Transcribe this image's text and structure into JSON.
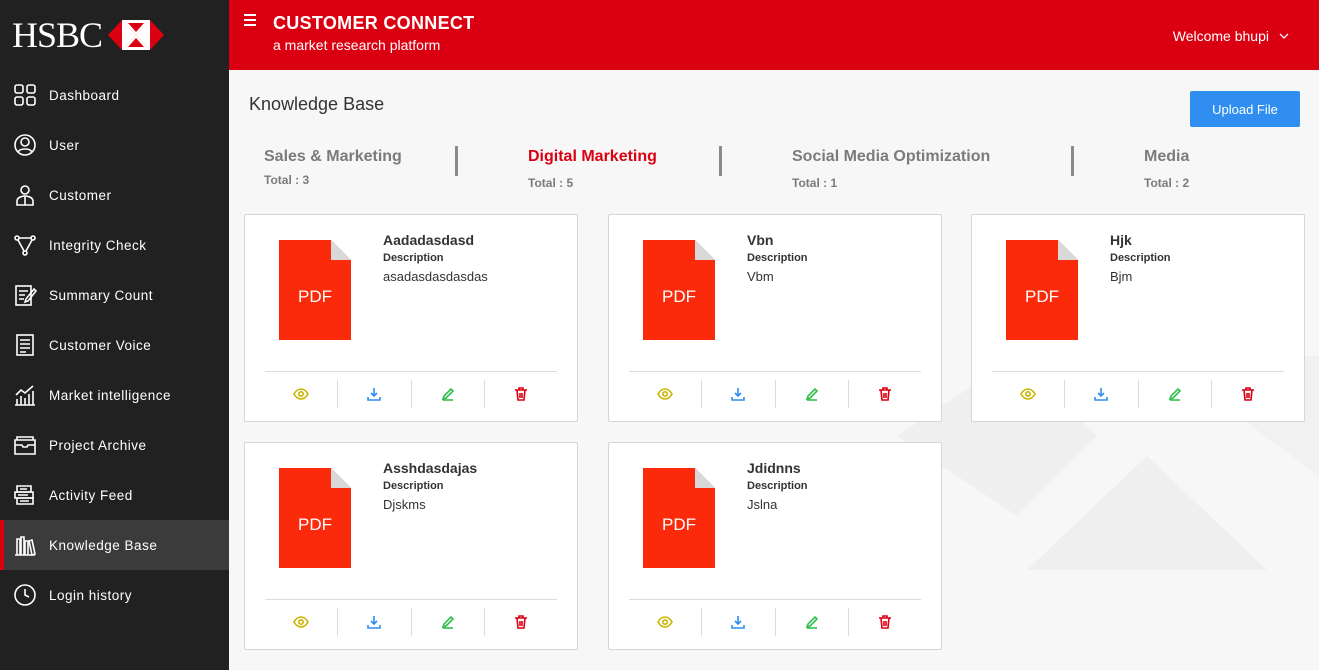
{
  "brand": {
    "logo_text": "HSBC",
    "title": "CUSTOMER CONNECT",
    "subtitle": "a market research platform"
  },
  "user": {
    "welcome": "Welcome bhupi"
  },
  "sidebar": {
    "items": [
      {
        "label": "Dashboard",
        "icon": "dashboard-icon"
      },
      {
        "label": "User",
        "icon": "user-icon"
      },
      {
        "label": "Customer",
        "icon": "customer-icon"
      },
      {
        "label": "Integrity Check",
        "icon": "integrity-check-icon"
      },
      {
        "label": "Summary Count",
        "icon": "summary-count-icon"
      },
      {
        "label": "Customer Voice",
        "icon": "customer-voice-icon"
      },
      {
        "label": "Market intelligence",
        "icon": "market-intelligence-icon"
      },
      {
        "label": "Project Archive",
        "icon": "project-archive-icon"
      },
      {
        "label": "Activity Feed",
        "icon": "activity-feed-icon"
      },
      {
        "label": "Knowledge Base",
        "icon": "knowledge-base-icon",
        "active": true
      },
      {
        "label": "Login history",
        "icon": "login-history-icon"
      }
    ]
  },
  "page": {
    "title": "Knowledge Base",
    "upload_label": "Upload File"
  },
  "tabs": [
    {
      "name": "Sales & Marketing",
      "total": "Total : 3"
    },
    {
      "name": "Digital Marketing",
      "total": "Total : 5",
      "active": true
    },
    {
      "name": "Social Media Optimization",
      "total": "Total : 1"
    },
    {
      "name": "Media",
      "total": "Total : 2"
    }
  ],
  "files": [
    {
      "title": "Aadadasdasd",
      "desc_label": "Description",
      "desc": "asadasdasdasdas",
      "type": "PDF"
    },
    {
      "title": "Vbn",
      "desc_label": "Description",
      "desc": "Vbm",
      "type": "PDF"
    },
    {
      "title": "Hjk",
      "desc_label": "Description",
      "desc": "Bjm",
      "type": "PDF"
    },
    {
      "title": "Asshdasdajas",
      "desc_label": "Description",
      "desc": "Djskms",
      "type": "PDF"
    },
    {
      "title": "Jdidnns",
      "desc_label": "Description",
      "desc": "Jslna",
      "type": "PDF"
    }
  ],
  "colors": {
    "brand_red": "#db0011",
    "sidebar_bg": "#212121",
    "upload_blue": "#2f8ef0",
    "pdf_red": "#fa2a0a",
    "view_icon": "#c9b400",
    "download_icon": "#2f8ef0",
    "edit_icon": "#2fbf4a",
    "delete_icon": "#db0011"
  }
}
